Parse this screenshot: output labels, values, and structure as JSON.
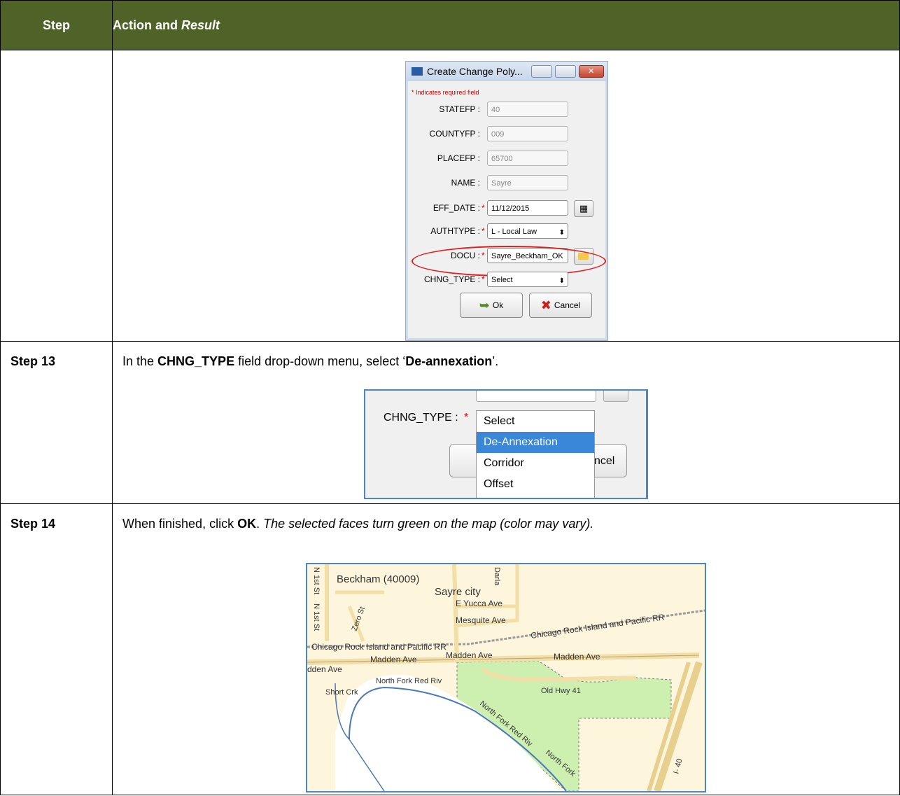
{
  "table": {
    "header": {
      "step": "Step",
      "action_plain": "Action and ",
      "action_italic": "Result"
    },
    "rows": [
      {
        "step": "",
        "text": ""
      },
      {
        "step": "Step 13",
        "text_pre": "In the ",
        "text_bold1": "CHNG_TYPE",
        "text_mid": " field drop-down menu, select ‘",
        "text_bold2": "De-annexation",
        "text_post": "’."
      },
      {
        "step": "Step 14",
        "text_pre": "When finished, click ",
        "text_bold": "OK",
        "text_mid": ". ",
        "text_italic": "The selected faces turn green on the map (color may vary)."
      }
    ]
  },
  "dialog": {
    "title": "Create Change Poly...",
    "required_note": "* Indicates required field",
    "fields": [
      {
        "label": "STATEFP :",
        "value": "40",
        "required": false
      },
      {
        "label": "COUNTYFP :",
        "value": "009",
        "required": false
      },
      {
        "label": "PLACEFP :",
        "value": "65700",
        "required": false
      },
      {
        "label": "NAME :",
        "value": "Sayre",
        "required": false
      },
      {
        "label": "EFF_DATE :",
        "value": "11/12/2015",
        "required": true
      },
      {
        "label": "AUTHTYPE :",
        "value": "L - Local Law",
        "required": true
      },
      {
        "label": "DOCU :",
        "value": "Sayre_Beckham_OK",
        "required": true
      },
      {
        "label": "CHNG_TYPE :",
        "value": "Select",
        "required": true
      }
    ],
    "ok_label": "Ok",
    "cancel_label": "Cancel",
    "icons": {
      "calendar": "calendar-icon",
      "folder": "folder-icon",
      "ok": "ok-arrow-icon",
      "cancel": "cancel-x-icon"
    }
  },
  "dropdown": {
    "label": "CHNG_TYPE :",
    "options": [
      "Select",
      "De-Annexation",
      "Corridor",
      "Offset"
    ],
    "highlighted": "De-Annexation",
    "behind_button_text": "ncel"
  },
  "map": {
    "labels": {
      "county": "Beckham (40009)",
      "city": "Sayre city",
      "yucca": "E Yucca Ave",
      "mesquite": "Mesquite Ave",
      "rr_right": "Chicago Rock Island and Pacific RR",
      "rr_left": "Chicago Rock Island and Pacific RR",
      "madden1": "Madden Ave",
      "madden2": "Madden Ave",
      "madden3": "Madden Ave",
      "madden_left": "dden Ave",
      "oldhwy": "Old Hwy 41",
      "nfork1": "North Fork Red Riv",
      "nfork2": "North Fork Red Riv",
      "nfork3": "North Fork",
      "shortcrk": "Short Crk",
      "zero": "Zero St",
      "n1st_a": "N 1st St",
      "n1st_b": "N 1st St",
      "darla": "Darla",
      "i40": "I- 40"
    },
    "colors": {
      "land": "#fdf5dc",
      "selected": "#cdf0b0",
      "water": "#ffffff",
      "river": "#4a78b8",
      "road": "#f2dfa8"
    }
  }
}
